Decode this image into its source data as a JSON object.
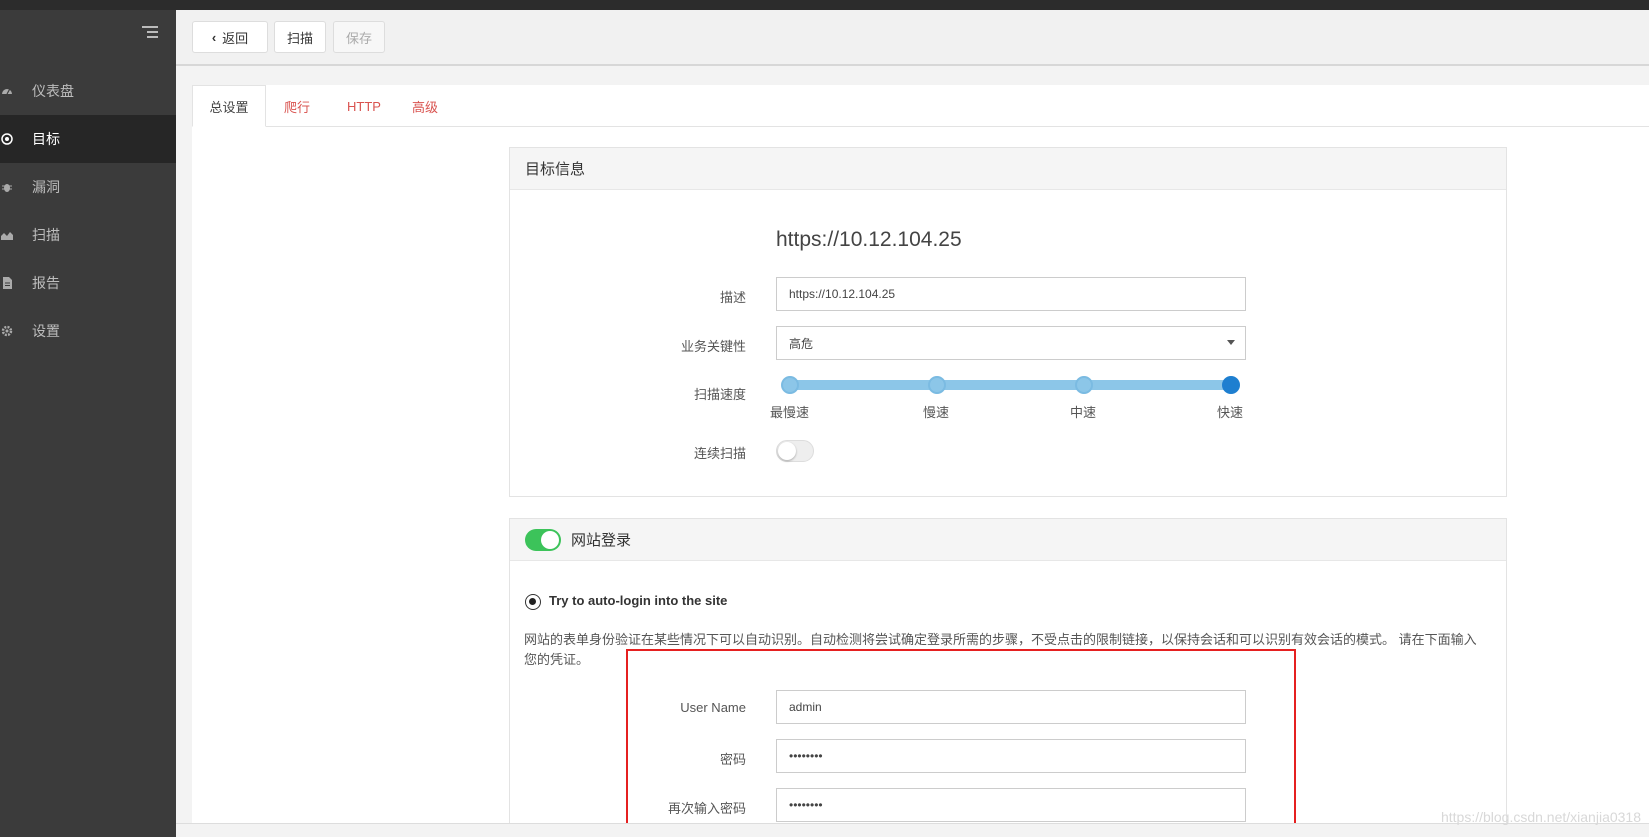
{
  "sidebar": {
    "items": [
      {
        "label": "仪表盘",
        "icon": "dashboard-icon",
        "active": false
      },
      {
        "label": "目标",
        "icon": "target-icon",
        "active": true
      },
      {
        "label": "漏洞",
        "icon": "bug-icon",
        "active": false
      },
      {
        "label": "扫描",
        "icon": "scan-chart-icon",
        "active": false
      },
      {
        "label": "报告",
        "icon": "report-icon",
        "active": false
      },
      {
        "label": "设置",
        "icon": "gear-icon",
        "active": false
      }
    ]
  },
  "toolbar": {
    "back_label": "返回",
    "scan_label": "扫描",
    "save_label": "保存"
  },
  "tabs": [
    {
      "label": "总设置",
      "active": true
    },
    {
      "label": "爬行",
      "active": false
    },
    {
      "label": "HTTP",
      "active": false
    },
    {
      "label": "高级",
      "active": false
    }
  ],
  "target_info": {
    "title": "目标信息",
    "url": "https://10.12.104.25",
    "description_label": "描述",
    "description_value": "https://10.12.104.25",
    "criticality_label": "业务关键性",
    "criticality_value": "高危",
    "speed_label": "扫描速度",
    "speed_options": [
      "最慢速",
      "慢速",
      "中速",
      "快速"
    ],
    "speed_selected_index": 3,
    "continuous_label": "连续扫描",
    "continuous_enabled": false
  },
  "site_login": {
    "title": "网站登录",
    "enabled": true,
    "radio_label": "Try to auto-login into the site",
    "description": "网站的表单身份验证在某些情况下可以自动识别。自动检测将尝试确定登录所需的步骤，不受点击的限制链接，以保持会话和可以识别有效会话的模式。 请在下面输入您的凭证。",
    "username_label": "User Name",
    "username_value": "admin",
    "password_label": "密码",
    "password_value": "••••••••",
    "password_confirm_label": "再次输入密码",
    "password_confirm_value": "••••••••"
  },
  "watermark": "https://blog.csdn.net/xianjia0318",
  "colors": {
    "sidebar_bg": "#3b3b3b",
    "sidebar_active": "#262626",
    "tab_link": "#d9534f",
    "slider": "#8cc6e8",
    "slider_selected": "#1e7fd0",
    "switch_on": "#3cc35a",
    "highlight": "#e52020"
  }
}
